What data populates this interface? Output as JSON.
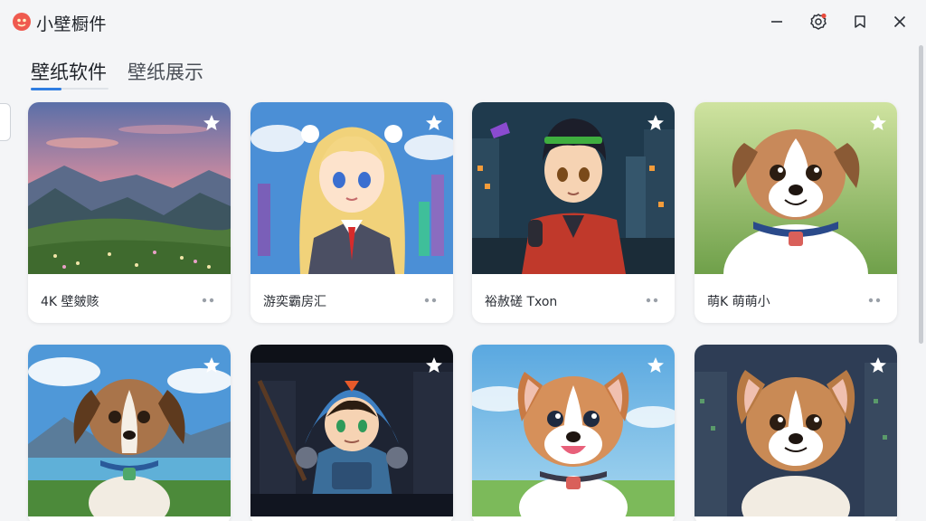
{
  "app": {
    "title": "小壁橱件",
    "logo_color": "#ef5a4f",
    "accent": "#2f7de1"
  },
  "window_controls": {
    "icons": [
      "minimize-icon",
      "settings-icon",
      "pin-icon",
      "close-icon"
    ],
    "notification_dot_color": "#e84a3c"
  },
  "tabs": [
    {
      "label": "壁纸软件",
      "active": true
    },
    {
      "label": "壁纸展示",
      "active": false
    }
  ],
  "cards": [
    {
      "label": "4K 壁皴赅",
      "scene": "mountain-sunset",
      "favorite_icon": "star-icon",
      "more_icon": "more-dots-icon"
    },
    {
      "label": "游奕霸房汇",
      "scene": "anime-girl",
      "favorite_icon": "star-icon",
      "more_icon": "more-dots-icon"
    },
    {
      "label": "裕赦磋 Txon",
      "scene": "anime-boy-city",
      "favorite_icon": "star-icon",
      "more_icon": "more-dots-icon"
    },
    {
      "label": "萌K 萌萌小",
      "scene": "puppy-meadow",
      "favorite_icon": "star-icon",
      "more_icon": "more-dots-icon"
    },
    {
      "label": "",
      "scene": "dog-lake",
      "favorite_icon": "star-icon"
    },
    {
      "label": "",
      "scene": "hooded-warrior",
      "favorite_icon": "star-icon"
    },
    {
      "label": "",
      "scene": "puppy-sky",
      "favorite_icon": "star-icon"
    },
    {
      "label": "",
      "scene": "puppy-night",
      "favorite_icon": "star-icon"
    }
  ]
}
